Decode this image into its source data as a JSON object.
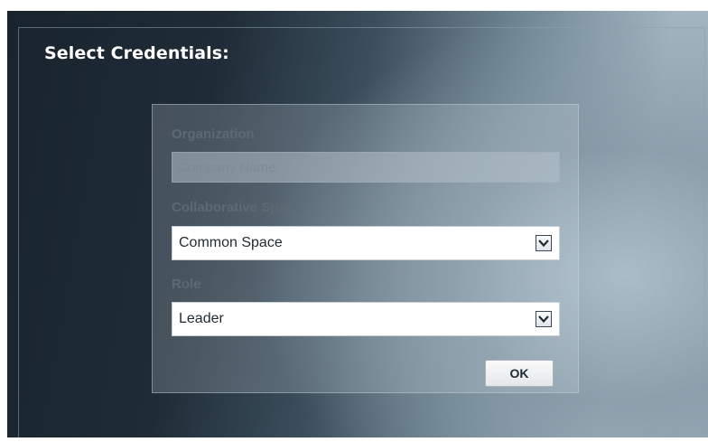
{
  "dialog": {
    "title": "Select Credentials:"
  },
  "form": {
    "organization": {
      "label": "Organization",
      "placeholder": "Company Name"
    },
    "collaborative_space": {
      "label": "Collaborative Space",
      "selected": "Common Space"
    },
    "role": {
      "label": "Role",
      "selected": "Leader"
    },
    "ok_label": "OK"
  },
  "icons": {
    "dropdown": "chevron-down-icon"
  }
}
